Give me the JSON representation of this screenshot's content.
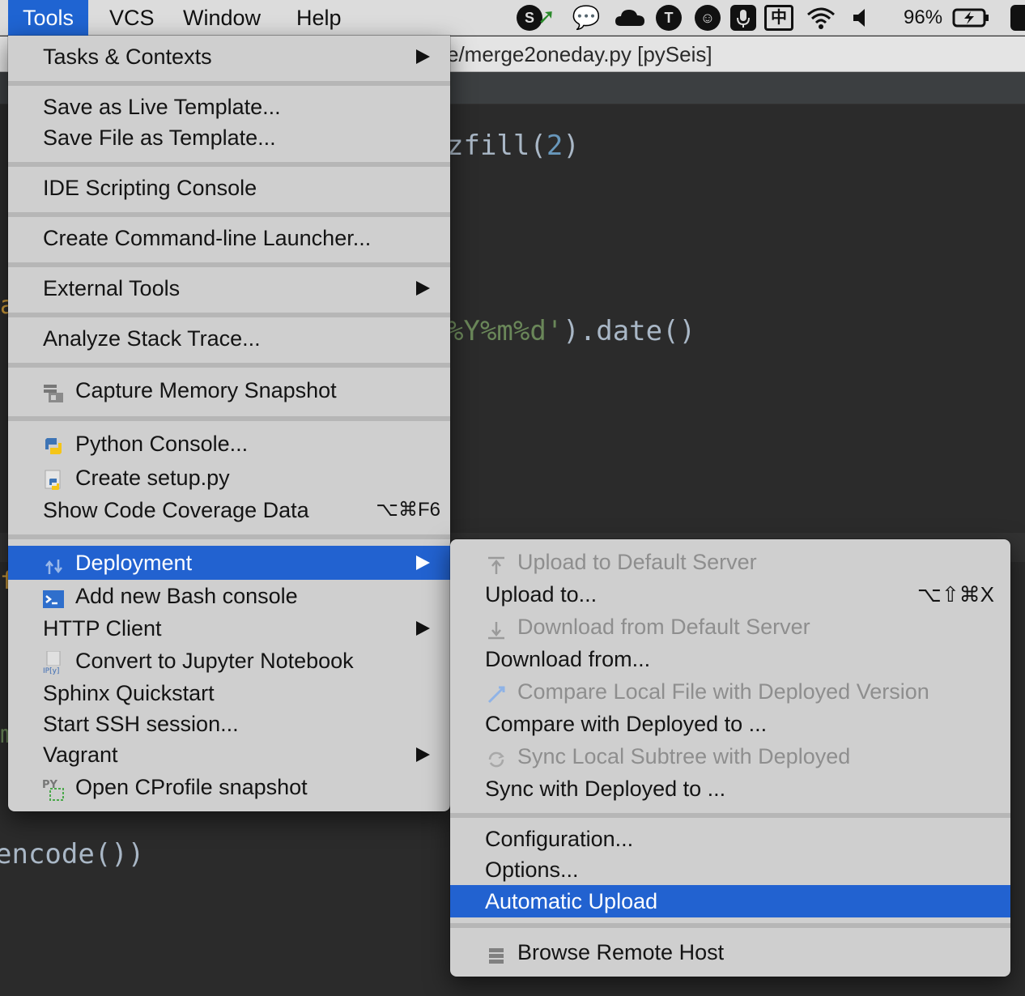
{
  "menubar": {
    "items": [
      "Tools",
      "VCS",
      "Window",
      "Help"
    ],
    "active": "Tools",
    "status": {
      "battery_percent": "96%",
      "icons": [
        "stocks-icon",
        "wechat-icon",
        "cloud-icon",
        "shield-icon",
        "smiley-icon",
        "microphone-icon",
        "input-method-icon",
        "wifi-icon",
        "volume-icon",
        "battery-icon",
        "app-icon"
      ]
    }
  },
  "window": {
    "title": "e/merge2oneday.py [pySeis]"
  },
  "editor": {
    "line1_a": "zfill(",
    "line1_num": "2",
    "line1_b": ")",
    "line2_str": "%Y%m%d'",
    "line2_b": ").date()",
    "line3": "encode())"
  },
  "tools_menu": {
    "items": {
      "tasks_contexts": "Tasks & Contexts",
      "save_live_template": "Save as Live Template...",
      "save_file_template": "Save File as Template...",
      "ide_scripting_console": "IDE Scripting Console",
      "create_launcher": "Create Command-line Launcher...",
      "external_tools": "External Tools",
      "analyze_stack_trace": "Analyze Stack Trace...",
      "capture_memory_snapshot": "Capture Memory Snapshot",
      "python_console": "Python Console...",
      "create_setup_py": "Create setup.py",
      "show_code_coverage": "Show Code Coverage Data",
      "show_code_coverage_shortcut": "⌥⌘F6",
      "deployment": "Deployment",
      "add_bash_console": "Add new Bash console",
      "http_client": "HTTP Client",
      "convert_jupyter": "Convert to Jupyter Notebook",
      "sphinx_quickstart": "Sphinx Quickstart",
      "start_ssh": "Start SSH session...",
      "vagrant": "Vagrant",
      "open_cprofile": "Open CProfile snapshot"
    }
  },
  "deployment_menu": {
    "items": {
      "upload_default": "Upload to Default Server",
      "upload_to": "Upload to...",
      "upload_to_shortcut": "⌥⇧⌘X",
      "download_default": "Download from Default Server",
      "download_from": "Download from...",
      "compare_local": "Compare Local File with Deployed Version",
      "compare_with": "Compare with Deployed to ...",
      "sync_local": "Sync Local Subtree with Deployed",
      "sync_with": "Sync with Deployed to ...",
      "configuration": "Configuration...",
      "options": "Options...",
      "automatic_upload": "Automatic Upload",
      "browse_remote": "Browse Remote Host"
    },
    "selected": "Automatic Upload"
  },
  "colors": {
    "selection": "#2262d0",
    "menu_bg": "#cfcfcf",
    "editor_bg": "#2b2b2b"
  }
}
